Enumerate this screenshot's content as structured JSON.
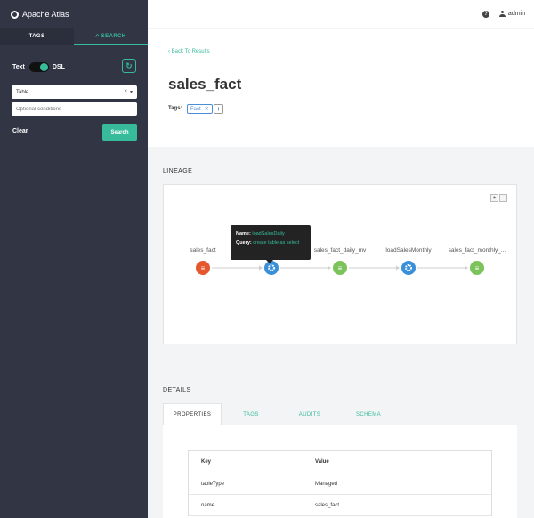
{
  "app": {
    "title": "Apache Atlas"
  },
  "sidebar": {
    "tabs": [
      {
        "label": "TAGS"
      },
      {
        "label": "SEARCH",
        "icon": "search-icon"
      }
    ],
    "toggle": {
      "left_label": "Text",
      "right_label": "DSL",
      "state": "on"
    },
    "type_select": {
      "value": "Table"
    },
    "conditions": {
      "placeholder": "Optional conditions"
    },
    "clear_label": "Clear",
    "search_label": "Search"
  },
  "topbar": {
    "user": "admin",
    "help_icon": "question-circle-icon",
    "user_icon": "user-icon"
  },
  "entity": {
    "back_label": "Back To Results",
    "title": "sales_fact",
    "tags_label": "Tags:",
    "tags": [
      {
        "name": "Fact"
      }
    ],
    "add_tag": "+"
  },
  "lineage": {
    "heading": "LINEAGE",
    "zoom_in": "+",
    "zoom_out": "-",
    "nodes": [
      {
        "label": "sales_fact",
        "kind": "table",
        "color": "#e5582f"
      },
      {
        "label": "",
        "kind": "process",
        "color": "#3a8fd9"
      },
      {
        "label": "sales_fact_daily_mv",
        "kind": "table",
        "color": "#7dc35b"
      },
      {
        "label": "loadSalesMonthly",
        "kind": "process",
        "color": "#3a8fd9"
      },
      {
        "label": "sales_fact_monthly_...",
        "kind": "table",
        "color": "#7dc35b"
      }
    ],
    "tooltip": {
      "name_label": "Name:",
      "name_value": "loadSalesDaily",
      "query_label": "Query:",
      "query_value": "create table as select"
    }
  },
  "details": {
    "heading": "DETAILS",
    "tabs": [
      "PROPERTIES",
      "TAGS",
      "AUDITS",
      "SCHEMA"
    ],
    "columns": [
      "Key",
      "Value"
    ],
    "rows": [
      {
        "key": "tableType",
        "value": "Managed"
      },
      {
        "key": "name",
        "value": "sales_fact"
      }
    ]
  },
  "colors": {
    "accent": "#37bb9b",
    "sidebar": "#323544",
    "tag_blue": "#4a90d9"
  }
}
